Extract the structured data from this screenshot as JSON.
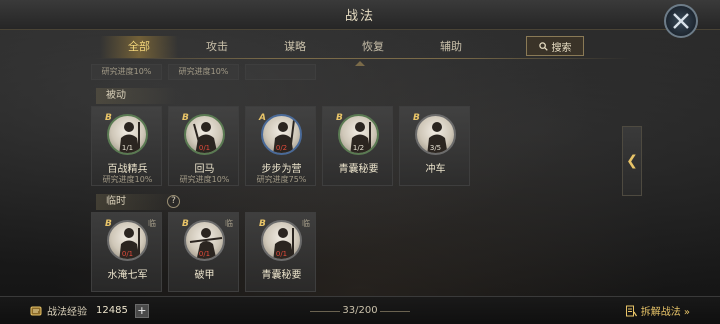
{
  "title": "战法",
  "tabs": [
    {
      "label": "全部",
      "active": true
    },
    {
      "label": "攻击",
      "active": false
    },
    {
      "label": "谋略",
      "active": false
    },
    {
      "label": "恢复",
      "active": false
    },
    {
      "label": "辅助",
      "active": false
    }
  ],
  "search": {
    "label": "搜索"
  },
  "top_partial": [
    {
      "sub": "研究进度10%"
    },
    {
      "sub": "研究进度10%"
    },
    {
      "sub": ""
    }
  ],
  "sections": {
    "passive": {
      "label": "被动",
      "cards": [
        {
          "grade": "B",
          "level": "1/1",
          "level_red": false,
          "name": "百战精兵",
          "sub": "研究进度10%",
          "ring": "green"
        },
        {
          "grade": "B",
          "level": "0/1",
          "level_red": true,
          "name": "回马",
          "sub": "研究进度10%",
          "ring": "green"
        },
        {
          "grade": "A",
          "level": "0/2",
          "level_red": true,
          "name": "步步为营",
          "sub": "研究进度75%",
          "ring": "blue"
        },
        {
          "grade": "B",
          "level": "1/2",
          "level_red": false,
          "name": "青囊秘要",
          "sub": "",
          "ring": "green"
        },
        {
          "grade": "B",
          "level": "3/5",
          "level_red": false,
          "name": "冲车",
          "sub": "",
          "ring": "plain"
        }
      ]
    },
    "temporary": {
      "label": "临时",
      "help": "?",
      "cards": [
        {
          "grade": "B",
          "level": "0/1",
          "level_red": true,
          "name": "水淹七军",
          "tag": "临",
          "ring": "plain"
        },
        {
          "grade": "B",
          "level": "0/1",
          "level_red": true,
          "name": "破甲",
          "tag": "临",
          "ring": "plain"
        },
        {
          "grade": "B",
          "level": "0/1",
          "level_red": true,
          "name": "青囊秘要",
          "tag": "临",
          "ring": "plain"
        }
      ]
    }
  },
  "side_handle": {
    "glyph": "❮"
  },
  "bottom": {
    "exp_label": "战法经验",
    "exp_value": "12485",
    "plus": "+",
    "count": "33/200",
    "disassemble_label": "拆解战法 »"
  },
  "colors": {
    "accent": "#e8c468",
    "red": "#e04a3a",
    "active_tab": "#f2d57a"
  },
  "icons": {
    "close": "close-x-icon",
    "search": "search-icon",
    "exp": "exp-scroll-icon",
    "disassemble": "disassemble-icon"
  }
}
